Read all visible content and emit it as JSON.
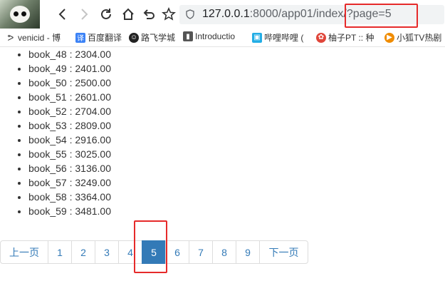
{
  "browser": {
    "url_host": "127.0.0.1",
    "url_rest": ":8000/app01/index/?page=5"
  },
  "bookmarks": [
    {
      "label": "venicid - 博",
      "icon": "venicid-icon"
    },
    {
      "label": "百度翻译",
      "icon": "baidu-translate-icon"
    },
    {
      "label": "路飞学城",
      "icon": "luffy-icon"
    },
    {
      "label": "Introductio",
      "icon": "book-icon"
    },
    {
      "label": "哔哩哔哩 (",
      "icon": "bilibili-icon"
    },
    {
      "label": "柚子PT :: 种",
      "icon": "youzi-icon"
    },
    {
      "label": "小狐TV热剧",
      "icon": "xiaohu-tv-icon"
    }
  ],
  "books": [
    "book_48 : 2304.00",
    "book_49 : 2401.00",
    "book_50 : 2500.00",
    "book_51 : 2601.00",
    "book_52 : 2704.00",
    "book_53 : 2809.00",
    "book_54 : 2916.00",
    "book_55 : 3025.00",
    "book_56 : 3136.00",
    "book_57 : 3249.00",
    "book_58 : 3364.00",
    "book_59 : 3481.00"
  ],
  "pagination": {
    "prev_label": "上一页",
    "next_label": "下一页",
    "pages": [
      "1",
      "2",
      "3",
      "4",
      "5",
      "6",
      "7",
      "8",
      "9"
    ],
    "active": "5"
  },
  "colors": {
    "accent": "#337ab7",
    "highlight": "#e62a2a"
  }
}
